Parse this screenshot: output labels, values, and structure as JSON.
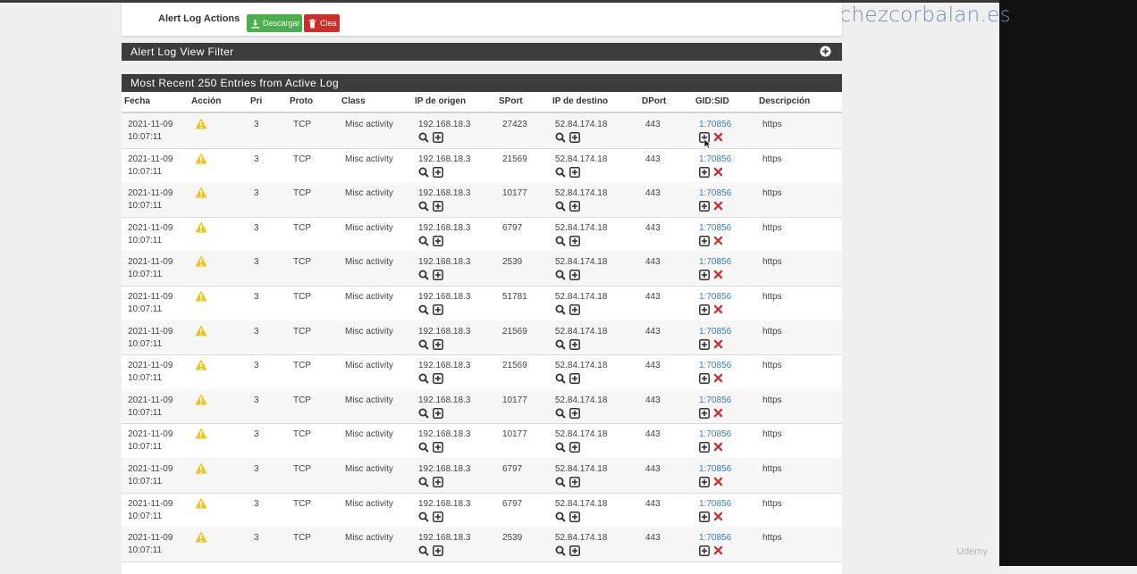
{
  "watermark": "sanchezcorbalan.es",
  "udemy": "Udemy",
  "actions": {
    "label": "Alert Log Actions",
    "download_label": "Descargar",
    "clear_label": "Clea"
  },
  "filter_heading": "Alert Log View Filter",
  "log_heading": "Most Recent 250 Entries from Active Log",
  "columns": [
    "Fecha",
    "Acción",
    "Pri",
    "Proto",
    "Class",
    "IP de origen",
    "SPort",
    "IP de destino",
    "DPort",
    "GID:SID",
    "Descripción"
  ],
  "rows": [
    {
      "date": "2021-11-09",
      "time": "10:07:11",
      "pri": "3",
      "proto": "TCP",
      "class": "Misc activity",
      "src": "192.168.18.3",
      "sport": "27423",
      "dst": "52.84.174.18",
      "dport": "443",
      "sid": "1:70856",
      "desc": "https"
    },
    {
      "date": "2021-11-09",
      "time": "10:07:11",
      "pri": "3",
      "proto": "TCP",
      "class": "Misc activity",
      "src": "192.168.18.3",
      "sport": "21569",
      "dst": "52.84.174.18",
      "dport": "443",
      "sid": "1:70856",
      "desc": "https"
    },
    {
      "date": "2021-11-09",
      "time": "10:07:11",
      "pri": "3",
      "proto": "TCP",
      "class": "Misc activity",
      "src": "192.168.18.3",
      "sport": "10177",
      "dst": "52.84.174.18",
      "dport": "443",
      "sid": "1:70856",
      "desc": "https"
    },
    {
      "date": "2021-11-09",
      "time": "10:07:11",
      "pri": "3",
      "proto": "TCP",
      "class": "Misc activity",
      "src": "192.168.18.3",
      "sport": "6797",
      "dst": "52.84.174.18",
      "dport": "443",
      "sid": "1:70856",
      "desc": "https"
    },
    {
      "date": "2021-11-09",
      "time": "10:07:11",
      "pri": "3",
      "proto": "TCP",
      "class": "Misc activity",
      "src": "192.168.18.3",
      "sport": "2539",
      "dst": "52.84.174.18",
      "dport": "443",
      "sid": "1:70856",
      "desc": "https"
    },
    {
      "date": "2021-11-09",
      "time": "10:07:11",
      "pri": "3",
      "proto": "TCP",
      "class": "Misc activity",
      "src": "192.168.18.3",
      "sport": "51781",
      "dst": "52.84.174.18",
      "dport": "443",
      "sid": "1:70856",
      "desc": "https"
    },
    {
      "date": "2021-11-09",
      "time": "10:07:11",
      "pri": "3",
      "proto": "TCP",
      "class": "Misc activity",
      "src": "192.168.18.3",
      "sport": "21569",
      "dst": "52.84.174.18",
      "dport": "443",
      "sid": "1:70856",
      "desc": "https"
    },
    {
      "date": "2021-11-09",
      "time": "10:07:11",
      "pri": "3",
      "proto": "TCP",
      "class": "Misc activity",
      "src": "192.168.18.3",
      "sport": "21569",
      "dst": "52.84.174.18",
      "dport": "443",
      "sid": "1:70856",
      "desc": "https"
    },
    {
      "date": "2021-11-09",
      "time": "10:07:11",
      "pri": "3",
      "proto": "TCP",
      "class": "Misc activity",
      "src": "192.168.18.3",
      "sport": "10177",
      "dst": "52.84.174.18",
      "dport": "443",
      "sid": "1:70856",
      "desc": "https"
    },
    {
      "date": "2021-11-09",
      "time": "10:07:11",
      "pri": "3",
      "proto": "TCP",
      "class": "Misc activity",
      "src": "192.168.18.3",
      "sport": "10177",
      "dst": "52.84.174.18",
      "dport": "443",
      "sid": "1:70856",
      "desc": "https"
    },
    {
      "date": "2021-11-09",
      "time": "10:07:11",
      "pri": "3",
      "proto": "TCP",
      "class": "Misc activity",
      "src": "192.168.18.3",
      "sport": "6797",
      "dst": "52.84.174.18",
      "dport": "443",
      "sid": "1:70856",
      "desc": "https"
    },
    {
      "date": "2021-11-09",
      "time": "10:07:11",
      "pri": "3",
      "proto": "TCP",
      "class": "Misc activity",
      "src": "192.168.18.3",
      "sport": "6797",
      "dst": "52.84.174.18",
      "dport": "443",
      "sid": "1:70856",
      "desc": "https"
    },
    {
      "date": "2021-11-09",
      "time": "10:07:11",
      "pri": "3",
      "proto": "TCP",
      "class": "Misc activity",
      "src": "192.168.18.3",
      "sport": "2539",
      "dst": "52.84.174.18",
      "dport": "443",
      "sid": "1:70856",
      "desc": "https"
    }
  ],
  "colors": {
    "heading_bg": "#3c3c3c",
    "download_green": "#4cae4c",
    "clear_red": "#c9302c",
    "warning_yellow": "#f0c419",
    "delete_red": "#c9302c",
    "link_blue": "#3a7bbf"
  },
  "icons": {
    "download": "download-icon",
    "clear": "trash-icon",
    "filter_toggle": "plus-circle-icon",
    "action": "warning-icon",
    "lookup": "search-icon",
    "add": "plus-square-icon",
    "delete": "close-icon"
  }
}
